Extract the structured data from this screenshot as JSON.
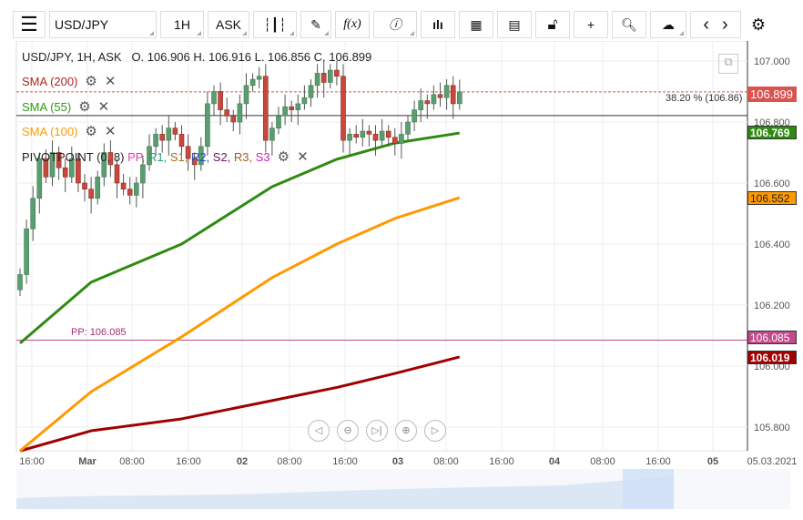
{
  "toolbar": {
    "symbol": "USD/JPY",
    "interval": "1H",
    "price_type": "ASK"
  },
  "info": {
    "symbol_line": "USD/JPY, 1H, ASK",
    "ohlc": "O. 106.906 H. 106.916 L. 106.856 C. 106.899"
  },
  "indicators": [
    {
      "label": "SMA (200)",
      "color": "#b22222"
    },
    {
      "label": "SMA (55)",
      "color": "#2e9c12"
    },
    {
      "label": "SMA (100)",
      "color": "#ff9900"
    }
  ],
  "pivot": {
    "label": "PIVOTPOINT (0, 8)",
    "parts": [
      {
        "t": "PP",
        "c": "#e040a0"
      },
      {
        "t": "R1",
        "c": "#20a070"
      },
      {
        "t": "S1",
        "c": "#a07020"
      },
      {
        "t": "R2",
        "c": "#2050c0"
      },
      {
        "t": "S2",
        "c": "#602060"
      },
      {
        "t": "R3",
        "c": "#a06020"
      },
      {
        "t": "S3",
        "c": "#d020c0"
      }
    ],
    "pp_label": "PP: 106.085"
  },
  "fib_label": "38.20 % (106.86)",
  "price_tags": {
    "last": "106.899",
    "sma55": "106.769",
    "sma100": "106.552",
    "pp": "106.085",
    "sma200": "106.019"
  },
  "chart_data": {
    "type": "candlestick",
    "ylim": [
      105.72,
      107.12
    ],
    "y_ticks": [
      "107.000",
      "106.800",
      "106.600",
      "106.400",
      "106.200",
      "106.000",
      "105.800"
    ],
    "x_ticks": [
      "16:00",
      "Mar",
      "08:00",
      "16:00",
      "02",
      "08:00",
      "16:00",
      "03",
      "08:00",
      "16:00",
      "04",
      "08:00",
      "16:00",
      "05",
      "05.03.2021"
    ],
    "closes": [
      106.3,
      106.45,
      106.55,
      106.68,
      106.62,
      106.7,
      106.65,
      106.62,
      106.68,
      106.6,
      106.58,
      106.55,
      106.62,
      106.7,
      106.66,
      106.6,
      106.58,
      106.56,
      106.6,
      106.66,
      106.72,
      106.76,
      106.74,
      106.78,
      106.76,
      106.72,
      106.68,
      106.66,
      106.72,
      106.86,
      106.9,
      106.84,
      106.82,
      106.8,
      106.86,
      106.92,
      106.94,
      106.95,
      106.74,
      106.78,
      106.82,
      106.85,
      106.84,
      106.86,
      106.88,
      106.92,
      106.96,
      106.93,
      106.97,
      106.95,
      106.74,
      106.76,
      106.75,
      106.77,
      106.76,
      106.74,
      106.77,
      106.75,
      106.73,
      106.76,
      106.8,
      106.84,
      106.87,
      106.86,
      106.89,
      106.88,
      106.92,
      106.86,
      106.899
    ],
    "sma55": [
      [
        0,
        106.075
      ],
      [
        11,
        106.275
      ],
      [
        25,
        106.4
      ],
      [
        39,
        106.588
      ],
      [
        49,
        106.678
      ],
      [
        58,
        106.731
      ],
      [
        68,
        106.764
      ]
    ],
    "sma100": [
      [
        0,
        105.722
      ],
      [
        11,
        105.916
      ],
      [
        25,
        106.096
      ],
      [
        39,
        106.29
      ],
      [
        49,
        106.4
      ],
      [
        58,
        106.484
      ],
      [
        68,
        106.552
      ]
    ],
    "sma200": [
      [
        0,
        105.722
      ],
      [
        11,
        105.788
      ],
      [
        25,
        105.827
      ],
      [
        39,
        105.887
      ],
      [
        49,
        105.93
      ],
      [
        58,
        105.976
      ],
      [
        68,
        106.03
      ]
    ],
    "pivot_pp": 106.085,
    "fib_level": 106.86,
    "last": 106.899
  }
}
